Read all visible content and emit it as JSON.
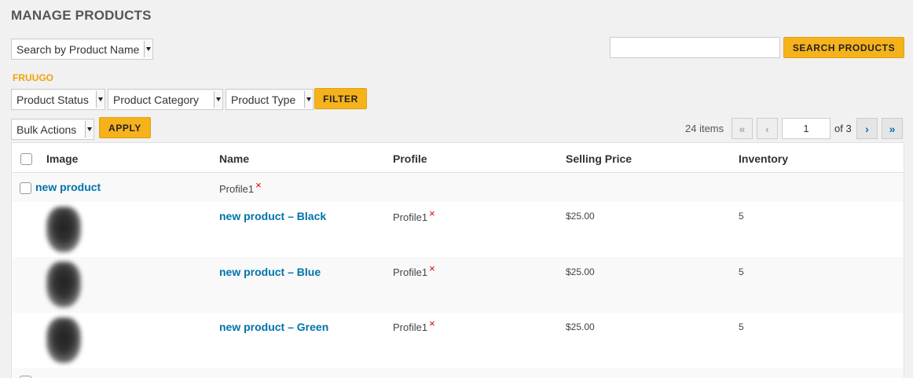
{
  "page": {
    "title": "MANAGE PRODUCTS"
  },
  "search": {
    "mode_select": "Search by Product Name",
    "input_value": "",
    "button": "SEARCH PRODUCTS"
  },
  "vendor": "FRUUGO",
  "filters": {
    "product_status": "Product Status",
    "product_category": "Product Category",
    "product_type": "Product Type",
    "filter_button": "FILTER"
  },
  "bulk": {
    "select": "Bulk Actions",
    "apply_button": "APPLY"
  },
  "pagination": {
    "items_count": "24 items",
    "first": "«",
    "prev": "‹",
    "current_page": "1",
    "of_total": "of 3",
    "next": "›",
    "last": "»"
  },
  "table": {
    "columns": [
      "Image",
      "Name",
      "Profile",
      "Selling Price",
      "Inventory"
    ],
    "parent_row": {
      "name": "new product",
      "profile": "Profile1"
    },
    "rows": [
      {
        "name": "new product – Black",
        "profile": "Profile1",
        "price": "$25.00",
        "inventory": "5"
      },
      {
        "name": "new product – Blue",
        "profile": "Profile1",
        "price": "$25.00",
        "inventory": "5"
      },
      {
        "name": "new product – Green",
        "profile": "Profile1",
        "price": "$25.00",
        "inventory": "5"
      }
    ]
  },
  "icons": {
    "remove_profile": "×"
  },
  "colors": {
    "accent": "#f6b21b",
    "link": "#0073aa",
    "vendor": "#f0a30a",
    "remove": "#dd0000"
  }
}
